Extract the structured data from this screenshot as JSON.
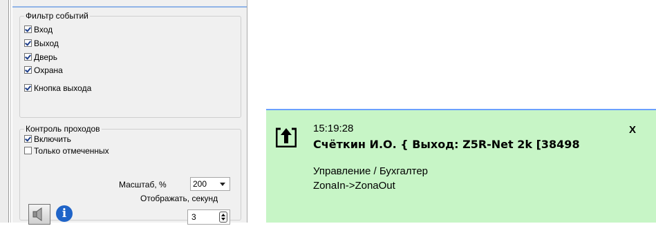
{
  "filter_group": {
    "title": "Фильтр событий",
    "items": [
      {
        "label": "Вход",
        "checked": true
      },
      {
        "label": "Выход",
        "checked": true
      },
      {
        "label": "Дверь",
        "checked": true
      },
      {
        "label": "Охрана",
        "checked": true
      },
      {
        "label": "Кнопка выхода",
        "checked": true
      }
    ]
  },
  "access_group": {
    "title": "Контроль проходов",
    "enable": {
      "label": "Включить",
      "checked": true
    },
    "only_marked": {
      "label": "Только отмеченных",
      "checked": false
    },
    "scale_label": "Масштаб, %",
    "scale_value": "200",
    "show_label": "Отображать, секунд",
    "show_value": "3",
    "sound_icon": "speaker-icon",
    "info_icon": "info-icon"
  },
  "notification": {
    "time": "15:19:28",
    "close": "X",
    "title": "Счёткин И.О. { Выход: Z5R-Net 2k [38498",
    "line1": "Управление / Бухгалтер",
    "line2": "ZonaIn->ZonaOut",
    "icon": "exit-arrow-icon",
    "background": "#c7f5c6"
  }
}
